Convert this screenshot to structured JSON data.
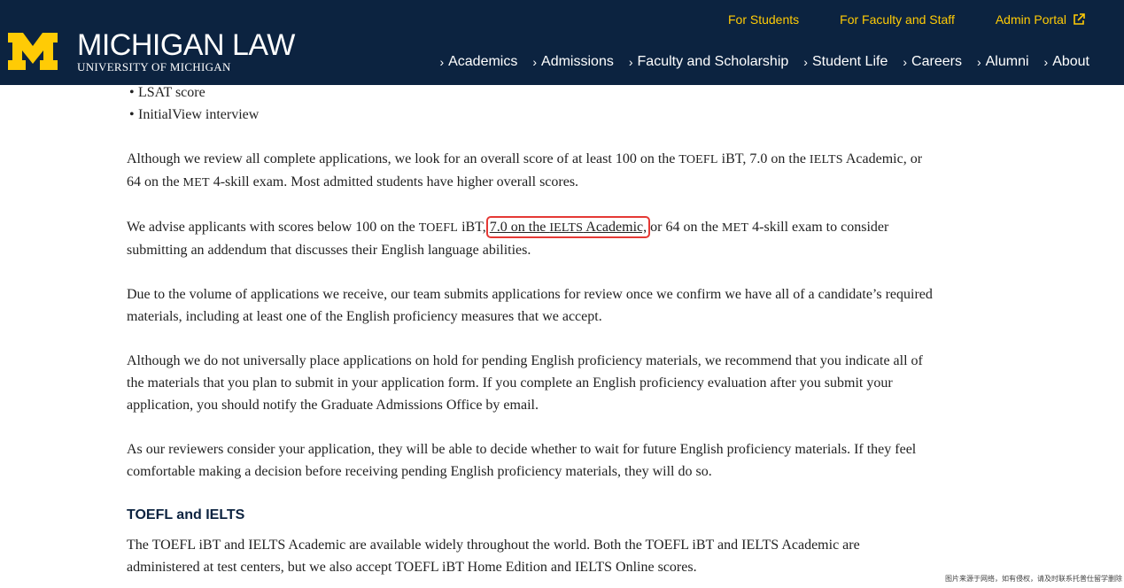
{
  "logo": {
    "title": "MICHIGAN LAW",
    "subtitle": "UNIVERSITY OF MICHIGAN",
    "icon": "block-m-logo",
    "brand_yellow": "#ffcb05",
    "brand_navy": "#0c2340"
  },
  "utility_nav": {
    "students": "For Students",
    "faculty": "For Faculty and Staff",
    "admin": "Admin Portal"
  },
  "main_nav": [
    "Academics",
    "Admissions",
    "Faculty and Scholarship",
    "Student Life",
    "Careers",
    "Alumni",
    "About"
  ],
  "bullets": [
    "LSAT score",
    "InitialView interview"
  ],
  "p1": {
    "a": "Although we review all complete applications, we look for an overall score of at least 100 on the ",
    "toefl": "TOEFL",
    "b": " iBT, 7.0 on the ",
    "ielts": "IELTS",
    "c": " Academic, or 64 on the ",
    "met": "MET",
    "d": " 4-skill exam. Most admitted students have higher overall scores."
  },
  "p2": {
    "a": "We advise applicants with scores below 100 on the ",
    "toefl": "TOEFL",
    "b": " iBT, ",
    "hl_a": "7.0 on the ",
    "hl_ielts": "IELTS",
    "hl_b": " Academic,",
    "c": " or 64 on the ",
    "met": "MET",
    "d": " 4-skill exam to consider submitting an addendum that discusses their English language abilities."
  },
  "p3": "Due to the volume of applications we receive, our team submits applications for review once we confirm we have all of a candidate’s required materials, including at least one of the English proficiency measures that we accept.",
  "p4": "Although we do not universally place applications on hold for pending English proficiency materials, we recommend that you indicate all of the materials that you plan to submit in your application form. If you complete an English proficiency evaluation after you submit your application, you should notify the Graduate Admissions Office by email.",
  "p5": "As our reviewers consider your application, they will be able to decide whether to wait for future English proficiency materials. If they feel comfortable making a decision before receiving pending English proficiency materials, they will do so.",
  "heading": "TOEFL and IELTS",
  "p6": {
    "a": "The ",
    "toefl1": "TOEFL",
    "b": " iBT and ",
    "ielts1": "IELTS",
    "c": " Academic are available widely throughout the world. Both the ",
    "toefl2": "TOEFL",
    "d": " iBT and ",
    "ielts2": "IELTS",
    "e": " Academic are administered at test centers, but we also accept ",
    "toefl3": "TOEFL",
    "f": " iBT Home Edition and ",
    "ielts3": "IELTS",
    "g": " Online scores."
  },
  "watermark": "图片来源于网络，如有侵权，请及时联系托普仕留学删除",
  "highlight_color": "#e53935"
}
